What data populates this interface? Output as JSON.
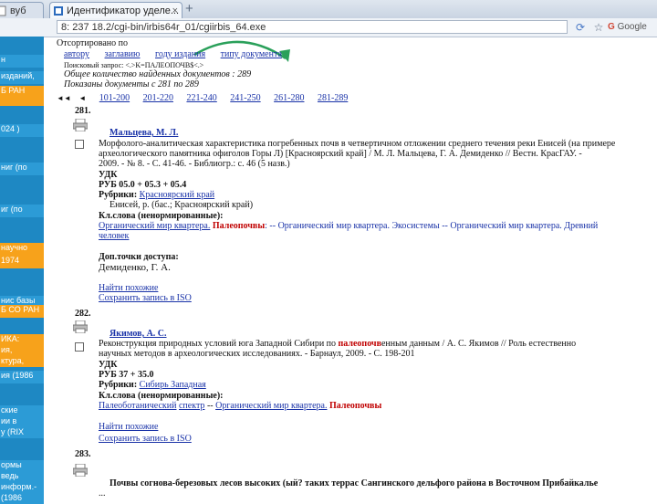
{
  "browser": {
    "tabs": [
      {
        "label": "вуб"
      },
      {
        "label": "Идентификатор уделе...",
        "close": "×"
      }
    ],
    "new_tab": "+",
    "url": "8: 237 18.2/cgi-bin/irbis64r_01/cgiirbis_64.exe",
    "search_engine": "Google"
  },
  "sidebar": {
    "items": [
      {
        "text": "н"
      },
      {
        "text": "изданий,"
      },
      {
        "text": "Б РАН"
      },
      {
        "text": "024 )"
      },
      {
        "text": "ниг (по"
      },
      {
        "text": "иг (по"
      },
      {
        "text": "научно"
      },
      {
        "text": "1974"
      },
      {
        "text": "ниc базы"
      },
      {
        "text": "Б СО РАН"
      },
      {
        "text": "ИКА:"
      },
      {
        "text": "ия,"
      },
      {
        "text": "ктура,"
      },
      {
        "text": "ия (1986"
      },
      {
        "text": "ские"
      },
      {
        "text": "ии в"
      },
      {
        "text": "у (RIX"
      },
      {
        "text": "ормы"
      },
      {
        "text": "ведь"
      },
      {
        "text": "информ.-"
      },
      {
        "text": "(1986"
      }
    ]
  },
  "sort": {
    "label": "Отсортировано по",
    "options": [
      "автору",
      "заглавию",
      "году издания",
      "типу документа"
    ]
  },
  "query": "Поисковый запрос: <.>K=ПАЛЕОПОЧВ$<.>",
  "found": "Общее количество найденных документов : 289",
  "shown": "Показаны документы с 281 по 289",
  "pagination": {
    "first": "◄◄",
    "prev": "◄",
    "pages": [
      "101-200",
      "201-220",
      "221-240",
      "241-250",
      "261-280",
      "281-289"
    ]
  },
  "records": [
    {
      "num": "281.",
      "author": "Мальцева, М. Л.",
      "text1": "Морфолого-аналитическая характеристика погребенных почв в четвертичном отложении среднего течения реки Енисей (на примере",
      "text2": "археологического памятника офиголов Горы Л) [Красноярский край] / М. Л. Мальцева, Г. А. Демиденко // Вестн. КрасГАУ. -",
      "text3": "2009. - № 8. - С. 41-46. - Библиогр.: с. 46 (5 назв.)",
      "udc": "УДК",
      "rub": "РУБ 05.0 + 05.3 + 05.4",
      "rubrics_label": "Рубрики:",
      "rubrics": "Красноярский край",
      "geo": "Енисей, р. (бас.; Красноярский край)",
      "kw_label": "Кл.слова (ненормированные):",
      "kw1a": "Органический мир квартера.",
      "kw1b": "Палеопочвы",
      "kw1c": ": -- Органический мир квартера. Экосистемы -- Органический мир квартера. Древний",
      "kw2": "человек",
      "extra_label": "Доп.точки доступа:",
      "extra": "Демиденко, Г. А.",
      "find": "Найти похожие",
      "save": "Сохранить запись в ISO"
    },
    {
      "num": "282.",
      "author": "Якимов, А. С.",
      "text1a": "Реконструкция природных условий юга Западной Сибири по",
      "text1b": "палеопочв",
      "text1c": "енным данным / А. С. Якимов // Роль естественно",
      "text2": "научных методов в археологических исследованиях. - Барнаул, 2009. - С. 198-201",
      "udc": "УДК",
      "rub": "РУБ 37 + 35.0",
      "rubrics_label": "Рубрики:",
      "rubrics": "Сибирь Западная",
      "kw_label": "Кл.слова (ненормированные):",
      "kw1a": "Палеоботанический",
      "kw1b": "спектр",
      "kw1c": "Органический мир квартера.",
      "kw1d": "Палеопочвы",
      "find": "Найти похожие",
      "save": "Сохранить запись в ISO"
    },
    {
      "num": "283.",
      "text1": "Почвы согнова-березовых лесов высоких (ый? таких террас Сангинского дельфого района в Восточном Прибайкалье",
      "text2": "..."
    }
  ]
}
